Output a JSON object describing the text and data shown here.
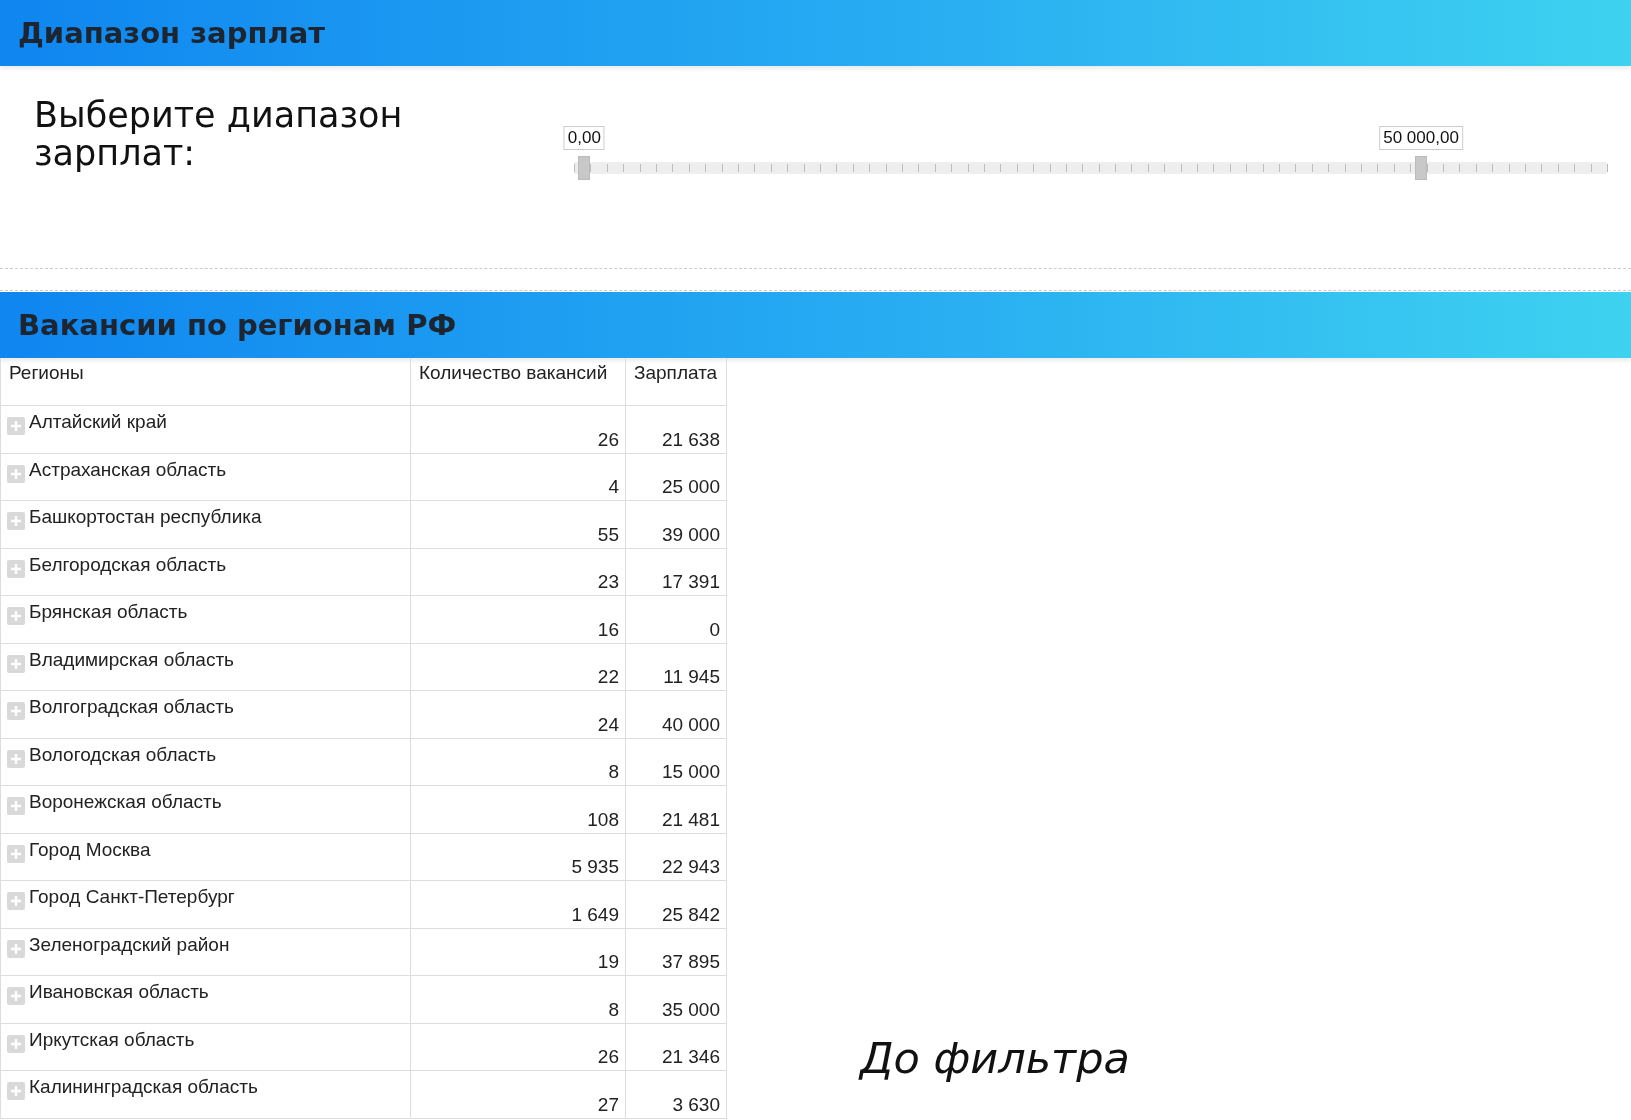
{
  "salary_panel": {
    "title": "Диапазон зарплат",
    "label": "Выберите диапазон зарплат:",
    "thumbs": [
      {
        "label": "0,00",
        "level": 0.01
      },
      {
        "label": "50 000,00",
        "level": 0.82
      }
    ]
  },
  "regions_panel": {
    "title": "Вакансии по регионам РФ",
    "table": {
      "columns": [
        "Регионы",
        "Количество вакансий",
        "Зарплата"
      ],
      "rows": [
        {
          "region": "Алтайский край",
          "expanded": false,
          "vacancies": "26",
          "salary": "21 638"
        },
        {
          "region": "Астраханская область",
          "expanded": false,
          "vacancies": "4",
          "salary": "25 000"
        },
        {
          "region": "Башкортостан республика",
          "expanded": false,
          "vacancies": "55",
          "salary": "39 000"
        },
        {
          "region": "Белгородская область",
          "expanded": false,
          "vacancies": "23",
          "salary": "17 391"
        },
        {
          "region": "Брянская область",
          "expanded": false,
          "vacancies": "16",
          "salary": "0"
        },
        {
          "region": "Владимирская область",
          "expanded": false,
          "vacancies": "22",
          "salary": "11 945"
        },
        {
          "region": "Волгоградская область",
          "expanded": false,
          "vacancies": "24",
          "salary": "40 000"
        },
        {
          "region": "Вологодская область",
          "expanded": false,
          "vacancies": "8",
          "salary": "15 000"
        },
        {
          "region": "Воронежская область",
          "expanded": false,
          "vacancies": "108",
          "salary": "21 481"
        },
        {
          "region": "Город Москва",
          "expanded": false,
          "vacancies": "5 935",
          "salary": "22 943"
        },
        {
          "region": "Город Санкт-Петербург",
          "expanded": false,
          "vacancies": "1 649",
          "salary": "25 842"
        },
        {
          "region": "Зеленоградский район",
          "expanded": false,
          "vacancies": "19",
          "salary": "37 895"
        },
        {
          "region": "Ивановская область",
          "expanded": false,
          "vacancies": "8",
          "salary": "35 000"
        },
        {
          "region": "Иркутская область",
          "expanded": false,
          "vacancies": "26",
          "salary": "21 346"
        },
        {
          "region": "Калининградская область",
          "expanded": false,
          "vacancies": "27",
          "salary": "3 630"
        }
      ]
    }
  },
  "caption": "До фильтра"
}
